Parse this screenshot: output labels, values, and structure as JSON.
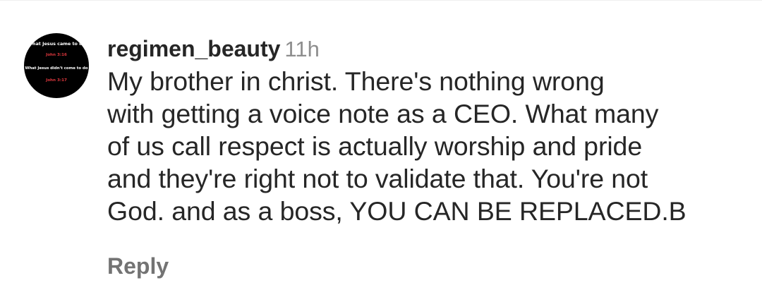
{
  "avatar": {
    "lines": [
      "What Jesus came to do",
      "John 3:16",
      "What Jesus didn't come to do",
      "John 3:17"
    ]
  },
  "comment": {
    "username": "regimen_beauty",
    "timestamp": "11h",
    "text_lines": [
      "My brother in christ. There's nothing wrong",
      "with getting a voice note as a CEO. What many",
      "of us call respect is actually worship and pride",
      "and they're right not to validate that. You're not",
      "God. and as a boss, YOU CAN BE REPLACED.B"
    ]
  },
  "actions": {
    "reply_label": "Reply"
  },
  "colors": {
    "text": "#262626",
    "secondary": "#8e8e8e",
    "reply": "#737373",
    "avatar_bg": "#000000",
    "avatar_accent": "#e0383e"
  }
}
